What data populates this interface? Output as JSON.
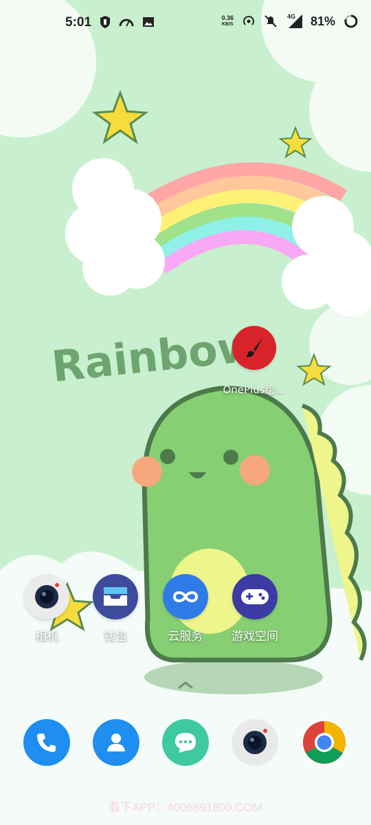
{
  "status_bar": {
    "time": "5:01",
    "speed_value": "0.36",
    "speed_unit": "KB/S",
    "network": "4G",
    "battery": "81%"
  },
  "wallpaper": {
    "text": "Rainbow"
  },
  "floating_app": {
    "label": "OnePlus绘…",
    "icon": "paintbrush-icon",
    "color": "#d9232b"
  },
  "home_apps": [
    {
      "label": "相机",
      "icon": "camera-icon"
    },
    {
      "label": "钱包",
      "icon": "wallet-icon"
    },
    {
      "label": "云服务",
      "icon": "cloud-service-icon"
    },
    {
      "label": "游戏空间",
      "icon": "gamepad-icon"
    }
  ],
  "dock": [
    {
      "icon": "phone-icon",
      "color": "#1f8ef1"
    },
    {
      "icon": "contacts-icon",
      "color": "#1f8ef1"
    },
    {
      "icon": "messages-icon",
      "color": "#3fc9a0"
    },
    {
      "icon": "camera-icon",
      "color": "#e9e9e9"
    },
    {
      "icon": "chrome-icon",
      "color": "#ffffff"
    }
  ],
  "watermark": "看下APP：4006891800.COM"
}
